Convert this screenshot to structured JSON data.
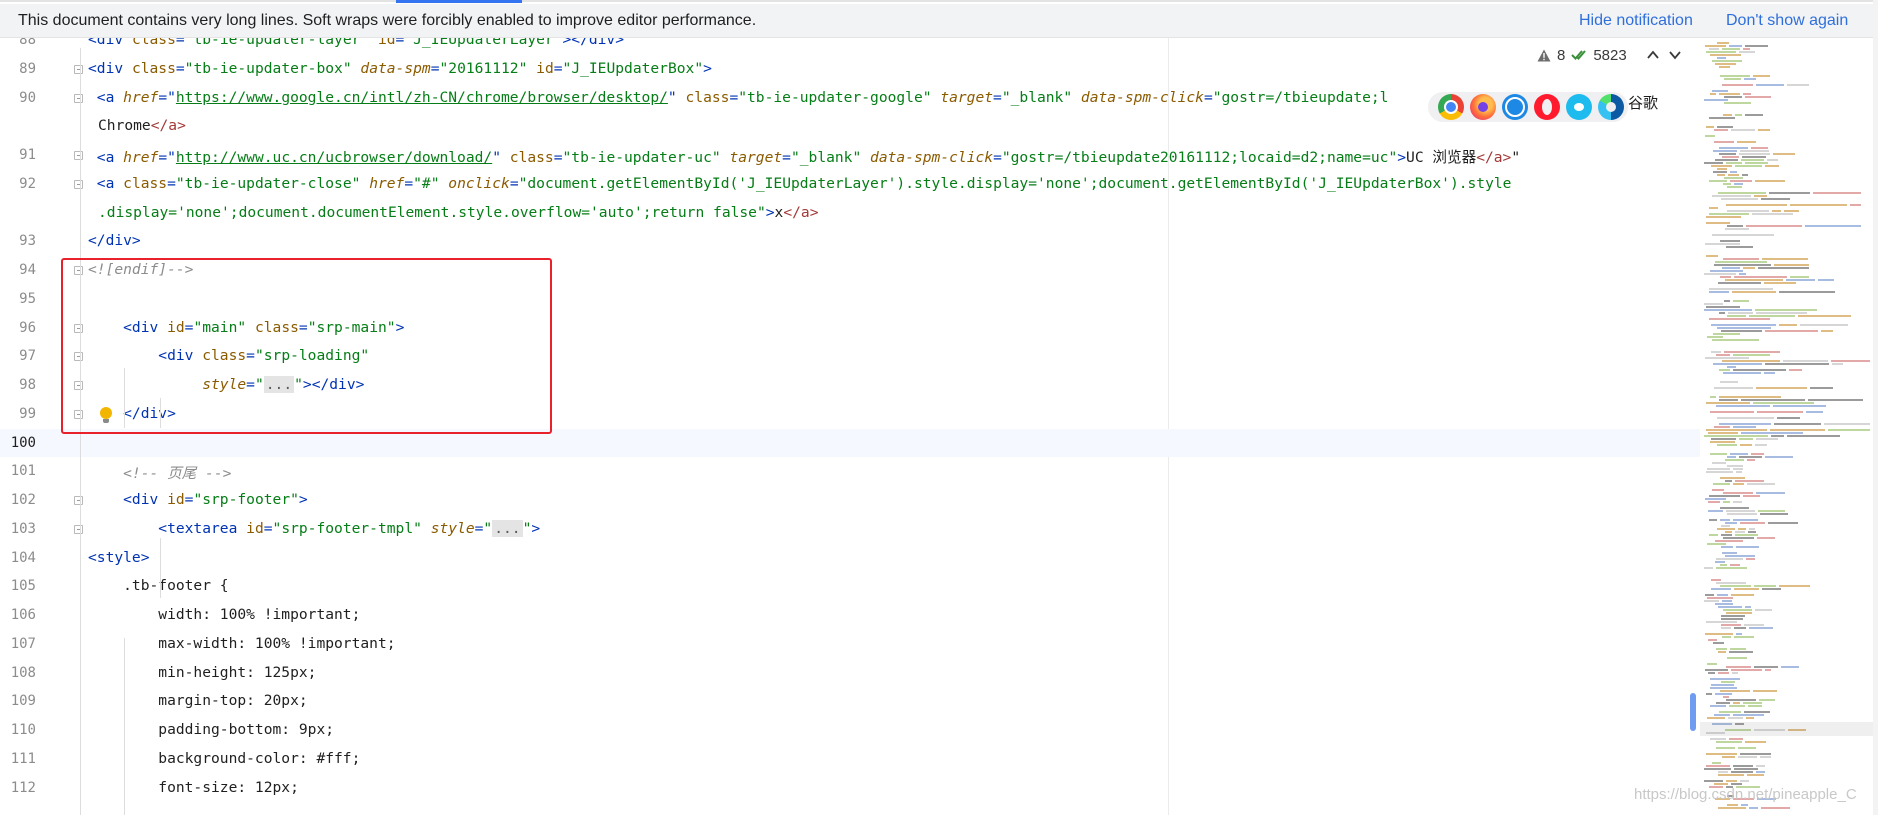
{
  "notification": {
    "message": "This document contains very long lines. Soft wraps were forcibly enabled to improve editor performance.",
    "hide_label": "Hide notification",
    "dont_show_label": "Don't show again"
  },
  "inspections": {
    "warnings": "8",
    "checks": "5823"
  },
  "browser_preview": {
    "browsers": [
      "chrome",
      "firefox",
      "safari",
      "opera",
      "internet-explorer",
      "edge"
    ],
    "trailing_text": "谷歌"
  },
  "editor": {
    "current_line": "100",
    "lines": [
      {
        "num": "88",
        "segs": [
          [
            "tag",
            "<div "
          ],
          [
            "attr",
            "class"
          ],
          [
            "tag",
            "="
          ],
          [
            "str",
            "\"tb-ie-updater-layer\" "
          ],
          [
            "attr",
            "id"
          ],
          [
            "tag",
            "="
          ],
          [
            "str",
            "\"J_IEUpdaterLayer\""
          ],
          [
            "tag",
            "></div>"
          ]
        ]
      },
      {
        "num": "89",
        "segs": [
          [
            "tag",
            "<div "
          ],
          [
            "attr",
            "class"
          ],
          [
            "tag",
            "="
          ],
          [
            "str",
            "\"tb-ie-updater-box\" "
          ],
          [
            "attr-i",
            "data-spm"
          ],
          [
            "tag",
            "="
          ],
          [
            "str",
            "\"20161112\" "
          ],
          [
            "attr",
            "id"
          ],
          [
            "tag",
            "="
          ],
          [
            "str",
            "\"J_IEUpdaterBox\""
          ],
          [
            "tag",
            ">"
          ]
        ]
      },
      {
        "num": "90",
        "segs": [
          [
            "tag",
            " <a "
          ],
          [
            "attr-i",
            "href"
          ],
          [
            "tag",
            "=\""
          ],
          [
            "link",
            "https://www.google.cn/intl/zh-CN/chrome/browser/desktop/"
          ],
          [
            "tag",
            "\" "
          ],
          [
            "attr",
            "class"
          ],
          [
            "tag",
            "="
          ],
          [
            "str",
            "\"tb-ie-updater-google\" "
          ],
          [
            "attr-i",
            "target"
          ],
          [
            "tag",
            "="
          ],
          [
            "str",
            "\"_blank\" "
          ],
          [
            "attr-i",
            "data-spm-click"
          ],
          [
            "tag",
            "="
          ],
          [
            "str",
            "\"gostr=/tbieupdate;l"
          ]
        ]
      },
      {
        "num": "",
        "segs": [
          [
            "prop",
            "Chrome"
          ],
          [
            "tag-r",
            "</a>"
          ]
        ]
      },
      {
        "num": "91",
        "segs": [
          [
            "tag",
            " <a "
          ],
          [
            "attr-i",
            "href"
          ],
          [
            "tag",
            "=\""
          ],
          [
            "link",
            "http://www.uc.cn/ucbrowser/download/"
          ],
          [
            "tag",
            "\" "
          ],
          [
            "attr",
            "class"
          ],
          [
            "tag",
            "="
          ],
          [
            "str",
            "\"tb-ie-updater-uc\" "
          ],
          [
            "attr-i",
            "target"
          ],
          [
            "tag",
            "="
          ],
          [
            "str",
            "\"_blank\" "
          ],
          [
            "attr-i",
            "data-spm-click"
          ],
          [
            "tag",
            "="
          ],
          [
            "str",
            "\"gostr=/tbieupdate20161112;locaid=d2;name=uc\""
          ],
          [
            "tag",
            ">"
          ],
          [
            "prop",
            "UC 浏览器"
          ],
          [
            "tag-r",
            "</a>"
          ],
          [
            "prop",
            "\""
          ]
        ]
      },
      {
        "num": "92",
        "segs": [
          [
            "tag",
            " <a "
          ],
          [
            "attr",
            "class"
          ],
          [
            "tag",
            "="
          ],
          [
            "str",
            "\"tb-ie-updater-close\" "
          ],
          [
            "attr-i",
            "href"
          ],
          [
            "tag",
            "="
          ],
          [
            "str",
            "\"#\" "
          ],
          [
            "attr-i",
            "onclick"
          ],
          [
            "tag",
            "="
          ],
          [
            "str",
            "\"document.getElementById('J_IEUpdaterLayer').style.display='none';document.getElementById('J_IEUpdaterBox').style"
          ]
        ]
      },
      {
        "num": "",
        "segs": [
          [
            "str",
            ".display='none';document.documentElement.style.overflow='auto';return false\""
          ],
          [
            "tag",
            ">"
          ],
          [
            "prop",
            "x"
          ],
          [
            "tag-r",
            "</a>"
          ]
        ]
      },
      {
        "num": "93",
        "segs": [
          [
            "tag",
            "</div>"
          ]
        ]
      },
      {
        "num": "94",
        "segs": [
          [
            "cmt",
            "<![endif]-->"
          ]
        ]
      },
      {
        "num": "95",
        "segs": []
      },
      {
        "num": "96",
        "segs": [
          [
            "tag",
            "    <div "
          ],
          [
            "attr",
            "id"
          ],
          [
            "tag",
            "="
          ],
          [
            "str",
            "\"main\" "
          ],
          [
            "attr",
            "class"
          ],
          [
            "tag",
            "="
          ],
          [
            "str",
            "\"srp-main\""
          ],
          [
            "tag",
            ">"
          ]
        ]
      },
      {
        "num": "97",
        "segs": [
          [
            "tag",
            "        <div "
          ],
          [
            "attr",
            "class"
          ],
          [
            "tag",
            "="
          ],
          [
            "str",
            "\"srp-loading\""
          ]
        ]
      },
      {
        "num": "98",
        "segs": [
          [
            "attr-i",
            "             style"
          ],
          [
            "tag",
            "="
          ],
          [
            "str",
            "\""
          ],
          [
            "fold-ph",
            "..."
          ],
          [
            "str",
            "\""
          ],
          [
            "tag",
            "></div>"
          ]
        ]
      },
      {
        "num": "99",
        "segs": [
          [
            "tag",
            "    </div>"
          ]
        ]
      },
      {
        "num": "100",
        "segs": []
      },
      {
        "num": "101",
        "segs": [
          [
            "cmt",
            "    <!-- 页尾 -->"
          ]
        ]
      },
      {
        "num": "102",
        "segs": [
          [
            "tag",
            "    <div "
          ],
          [
            "attr",
            "id"
          ],
          [
            "tag",
            "="
          ],
          [
            "str",
            "\"srp-footer\""
          ],
          [
            "tag",
            ">"
          ]
        ]
      },
      {
        "num": "103",
        "segs": [
          [
            "tag",
            "        <textarea "
          ],
          [
            "attr",
            "id"
          ],
          [
            "tag",
            "="
          ],
          [
            "str",
            "\"srp-footer-tmpl\" "
          ],
          [
            "attr-i",
            "style"
          ],
          [
            "tag",
            "="
          ],
          [
            "str",
            "\""
          ],
          [
            "fold-ph",
            "..."
          ],
          [
            "str",
            "\""
          ],
          [
            "tag",
            ">"
          ]
        ]
      },
      {
        "num": "104",
        "segs": [
          [
            "tag",
            "<style>"
          ]
        ]
      },
      {
        "num": "105",
        "segs": [
          [
            "prop",
            "    .tb-footer {"
          ]
        ]
      },
      {
        "num": "106",
        "segs": [
          [
            "prop",
            "        width: 100% !important;"
          ]
        ]
      },
      {
        "num": "107",
        "segs": [
          [
            "prop",
            "        max-width: 100% !important;"
          ]
        ]
      },
      {
        "num": "108",
        "segs": [
          [
            "prop",
            "        min-height: 125px;"
          ]
        ]
      },
      {
        "num": "109",
        "segs": [
          [
            "prop",
            "        margin-top: 20px;"
          ]
        ]
      },
      {
        "num": "110",
        "segs": [
          [
            "prop",
            "        padding-bottom: 9px;"
          ]
        ]
      },
      {
        "num": "111",
        "segs": [
          [
            "prop",
            "        background-color: #fff;"
          ]
        ]
      },
      {
        "num": "112",
        "segs": [
          [
            "prop",
            "        font-size: 12px;"
          ]
        ]
      }
    ]
  },
  "watermark": "https://blog.csdn.net/pineapple_C"
}
